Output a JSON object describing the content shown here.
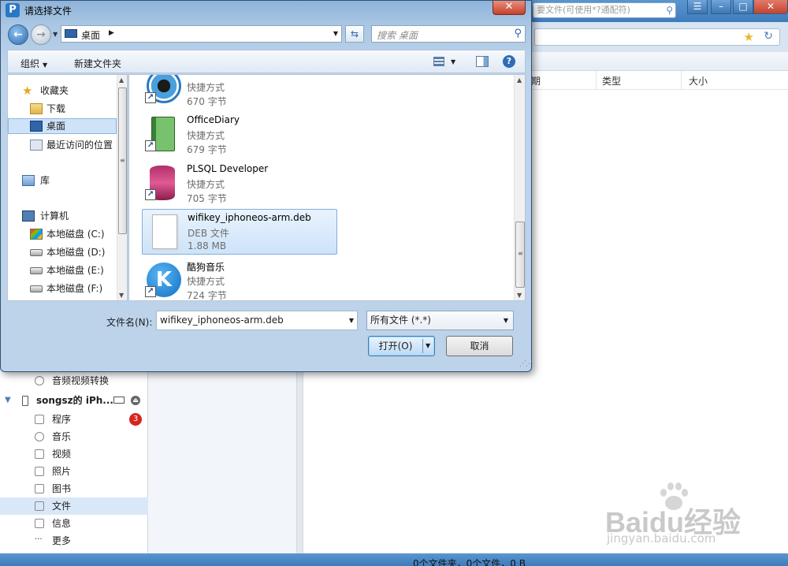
{
  "background_app": {
    "search_placeholder": "要文件(可使用*?通配符)",
    "column_headers": [
      "期",
      "类型",
      "大小"
    ],
    "sidebar": {
      "items": [
        {
          "label": "音频视频转换",
          "icon": "headphones-icon"
        },
        {
          "label": "程序",
          "icon": "apps-icon",
          "badge": "3"
        },
        {
          "label": "音乐",
          "icon": "headphones-icon"
        },
        {
          "label": "视频",
          "icon": "film-icon"
        },
        {
          "label": "照片",
          "icon": "photo-icon"
        },
        {
          "label": "图书",
          "icon": "book-icon"
        },
        {
          "label": "文件",
          "icon": "file-icon",
          "selected": true
        },
        {
          "label": "信息",
          "icon": "message-icon"
        },
        {
          "label": "更多",
          "icon": "more-icon"
        }
      ],
      "device_name": "songsz的 iPh..."
    },
    "status_text": "0个文件夹，0个文件，0 B",
    "watermark": {
      "logo": "Baidu经验",
      "site": "jingyan.baidu.com"
    }
  },
  "dialog": {
    "title": "请选择文件",
    "close_glyph": "✕",
    "address_path": "桌面",
    "search_placeholder": "搜索 桌面",
    "toolbar": {
      "organize": "组织",
      "new_folder": "新建文件夹"
    },
    "nav": {
      "items": [
        {
          "label": "收藏夹",
          "icon": "star-icon"
        },
        {
          "label": "下载",
          "icon": "download-folder-icon"
        },
        {
          "label": "桌面",
          "icon": "desktop-icon",
          "selected": true
        },
        {
          "label": "最近访问的位置",
          "icon": "recent-places-icon"
        },
        {
          "label": "库",
          "icon": "library-icon"
        },
        {
          "label": "计算机",
          "icon": "computer-icon"
        },
        {
          "label": "本地磁盘 (C:)",
          "icon": "drive-c-icon"
        },
        {
          "label": "本地磁盘 (D:)",
          "icon": "drive-icon"
        },
        {
          "label": "本地磁盘 (E:)",
          "icon": "drive-icon"
        },
        {
          "label": "本地磁盘 (F:)",
          "icon": "drive-icon"
        }
      ]
    },
    "files": [
      {
        "name": "",
        "type": "快捷方式",
        "size": "670 字节",
        "icon": "eye-app-icon",
        "shortcut": true
      },
      {
        "name": "OfficeDiary",
        "type": "快捷方式",
        "size": "679 字节",
        "icon": "diary-book-icon",
        "shortcut": true
      },
      {
        "name": "PLSQL Developer",
        "type": "快捷方式",
        "size": "705 字节",
        "icon": "database-icon",
        "shortcut": true
      },
      {
        "name": "wifikey_iphoneos-arm.deb",
        "type": "DEB 文件",
        "size": "1.88 MB",
        "icon": "document-icon",
        "selected": true
      },
      {
        "name": "酷狗音乐",
        "type": "快捷方式",
        "size": "724 字节",
        "icon": "kugou-icon",
        "shortcut": true
      }
    ],
    "filename_label": "文件名(N):",
    "filename_value": "wifikey_iphoneos-arm.deb",
    "filter_value": "所有文件 (*.*)",
    "open_button": "打开(O)",
    "cancel_button": "取消"
  },
  "colors": {
    "title_bar": "#3f7cbb",
    "selection": "#cde3f9",
    "badge": "#d6261d"
  }
}
